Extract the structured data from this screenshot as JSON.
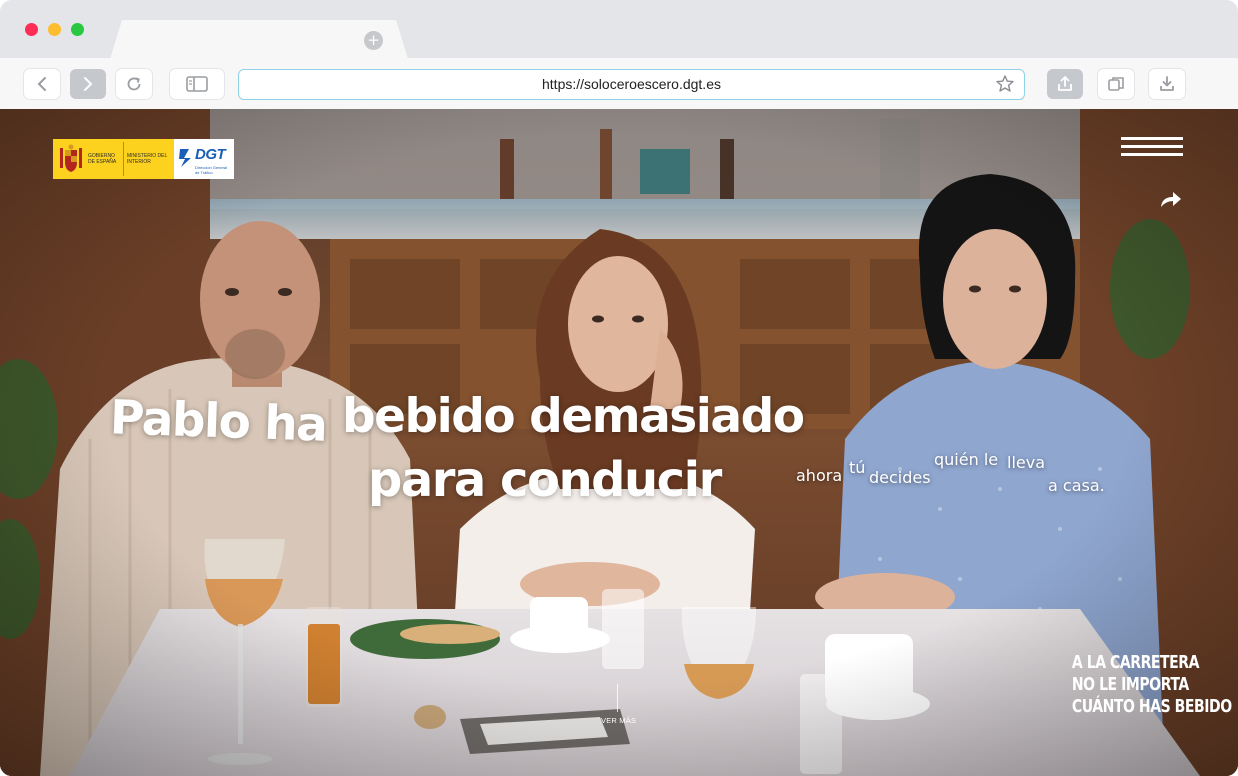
{
  "browser": {
    "url": "https://soloceroescero.dgt.es",
    "new_tab_glyph": "+",
    "icons": [
      "back-icon",
      "forward-icon",
      "reload-icon",
      "sidebar-icon",
      "star-icon",
      "share-icon",
      "tabs-icon",
      "download-icon",
      "more-icon"
    ]
  },
  "logo": {
    "gov_line": "Gobierno de España",
    "ministry_line": "Ministerio del Interior",
    "dgt_word": "DGT",
    "dgt_sub": "Dirección General de Tráfico"
  },
  "hero": {
    "headline_part1": "Pablo ha",
    "headline_part2": "bebido demasiado",
    "headline_part3": "para conducir",
    "tagline_words": [
      "ahora",
      "tú",
      "decides",
      "quién le",
      "lleva",
      "a casa."
    ],
    "slogan_lines": [
      "A LA CARRETERA",
      "NO LE IMPORTA",
      "CUÁNTO HAS BEBIDO"
    ],
    "ver_mas": "VER MÁS"
  },
  "colors": {
    "gov_yellow": "#fdd21f",
    "dgt_blue": "#1a5eb8",
    "url_focus": "#8fd3e8",
    "traffic_red": "#fe2d55",
    "traffic_yellow": "#fdbd2e",
    "traffic_green": "#28c840"
  }
}
